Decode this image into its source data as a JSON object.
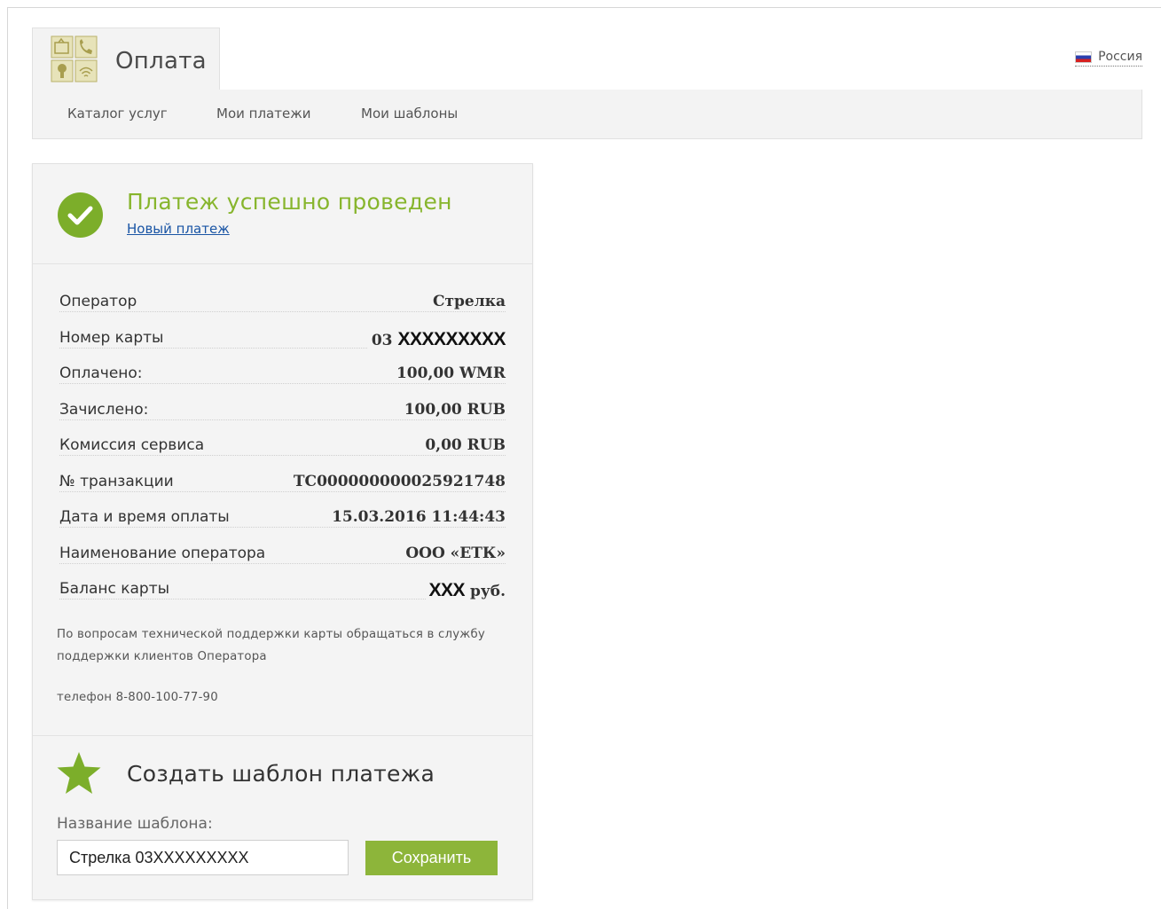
{
  "header": {
    "title": "Оплата",
    "language": "Россия"
  },
  "nav": [
    {
      "label": "Каталог услуг"
    },
    {
      "label": "Мои платежи"
    },
    {
      "label": "Мои шаблоны"
    }
  ],
  "result": {
    "title": "Платеж успешно проведен",
    "new_payment_link": "Новый платеж"
  },
  "details": [
    {
      "label": "Оператор",
      "value": "Стрелка"
    },
    {
      "label": "Номер карты",
      "value_prefix": "03",
      "value_masked": "XXXXXXXXX"
    },
    {
      "label": "Оплачено:",
      "value": "100,00 WMR"
    },
    {
      "label": "Зачислено:",
      "value": "100,00 RUB"
    },
    {
      "label": "Комиссия сервиса",
      "value": "0,00 RUB"
    },
    {
      "label": "№ транзакции",
      "value": "TC000000000025921748"
    },
    {
      "label": "Дата и время оплаты",
      "value": "15.03.2016 11:44:43"
    },
    {
      "label": "Наименование оператора",
      "value": "ООО «ЕТК»"
    },
    {
      "label": "Баланс карты",
      "value_masked": "XXX",
      "value_suffix": "руб."
    }
  ],
  "support_note": "По вопросам технической поддержки карты обращаться в службу поддержки клиентов Оператора",
  "support_phone": "телефон 8-800-100-77-90",
  "template": {
    "title": "Создать шаблон платежа",
    "name_label": "Название шаблона:",
    "name_value": "Стрелка 03XXXXXXXXX",
    "save_label": "Сохранить"
  },
  "colors": {
    "success_green": "#87b52d",
    "button_green": "#8db53a",
    "link_blue": "#1a55a5"
  }
}
